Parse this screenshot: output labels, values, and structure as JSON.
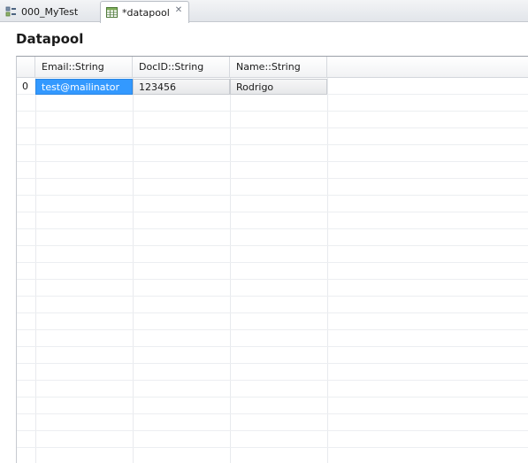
{
  "tabs": [
    {
      "label": "000_MyTest",
      "icon": "test-suite-icon",
      "active": false
    },
    {
      "label": "*datapool",
      "icon": "table-icon",
      "active": true,
      "close": "✕"
    }
  ],
  "page": {
    "title": "Datapool"
  },
  "table": {
    "columns": [
      "",
      "Email::String",
      "DocID::String",
      "Name::String"
    ],
    "rows": [
      {
        "index": "0",
        "email": "test@mailinator",
        "docid": "123456",
        "name": "Rodrigo"
      }
    ],
    "selected_cell": "email"
  },
  "colors": {
    "selection": "#3399ff",
    "tab_bar": "#e2e5ea",
    "grid": "#eceef1"
  }
}
